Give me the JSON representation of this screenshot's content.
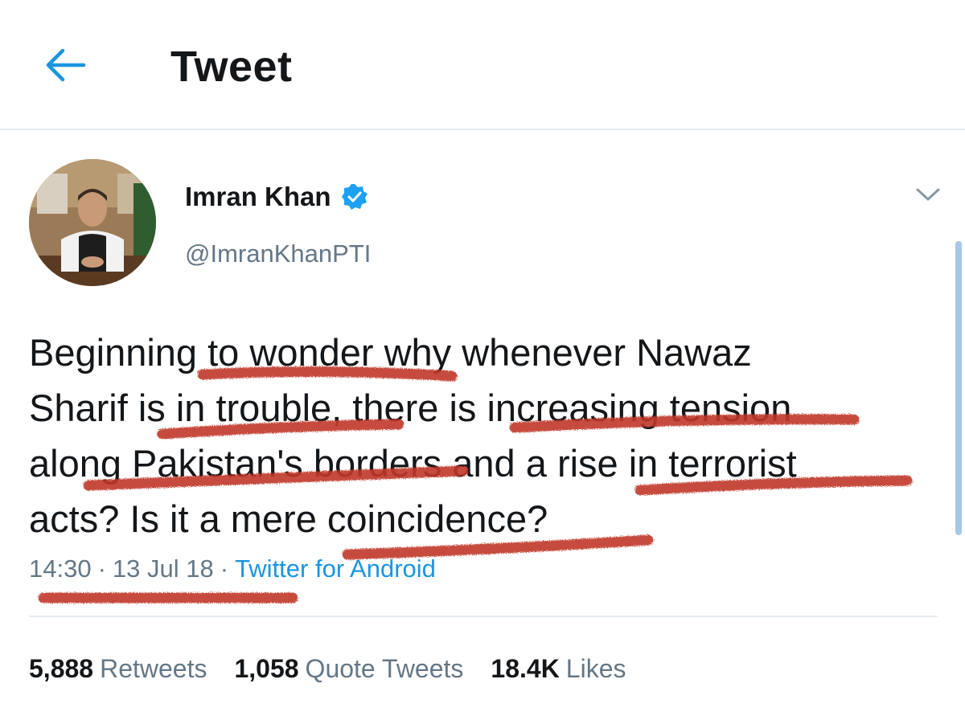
{
  "header": {
    "title": "Tweet",
    "back_icon": "arrow-left-icon"
  },
  "author": {
    "name": "Imran Khan",
    "handle": "@ImranKhanPTI",
    "verified_icon": "verified-badge-icon"
  },
  "tweet": {
    "lines": [
      "Beginning to wonder why whenever Nawaz",
      "Sharif is in trouble, there is increasing tension",
      "along Pakistan's borders and a rise in terrorist",
      "acts? Is it a mere coincidence?"
    ],
    "time": "14:30",
    "date": "13 Jul 18",
    "source": "Twitter for Android",
    "separator": "·"
  },
  "stats": {
    "retweets_count": "5,888",
    "retweets_label": "Retweets",
    "quote_count": "1,058",
    "quote_label": "Quote Tweets",
    "likes_count": "18.4K",
    "likes_label": "Likes"
  },
  "colors": {
    "accent": "#1b95e0",
    "text": "#14171a",
    "secondary": "#657786",
    "marker": "#c0392b"
  }
}
